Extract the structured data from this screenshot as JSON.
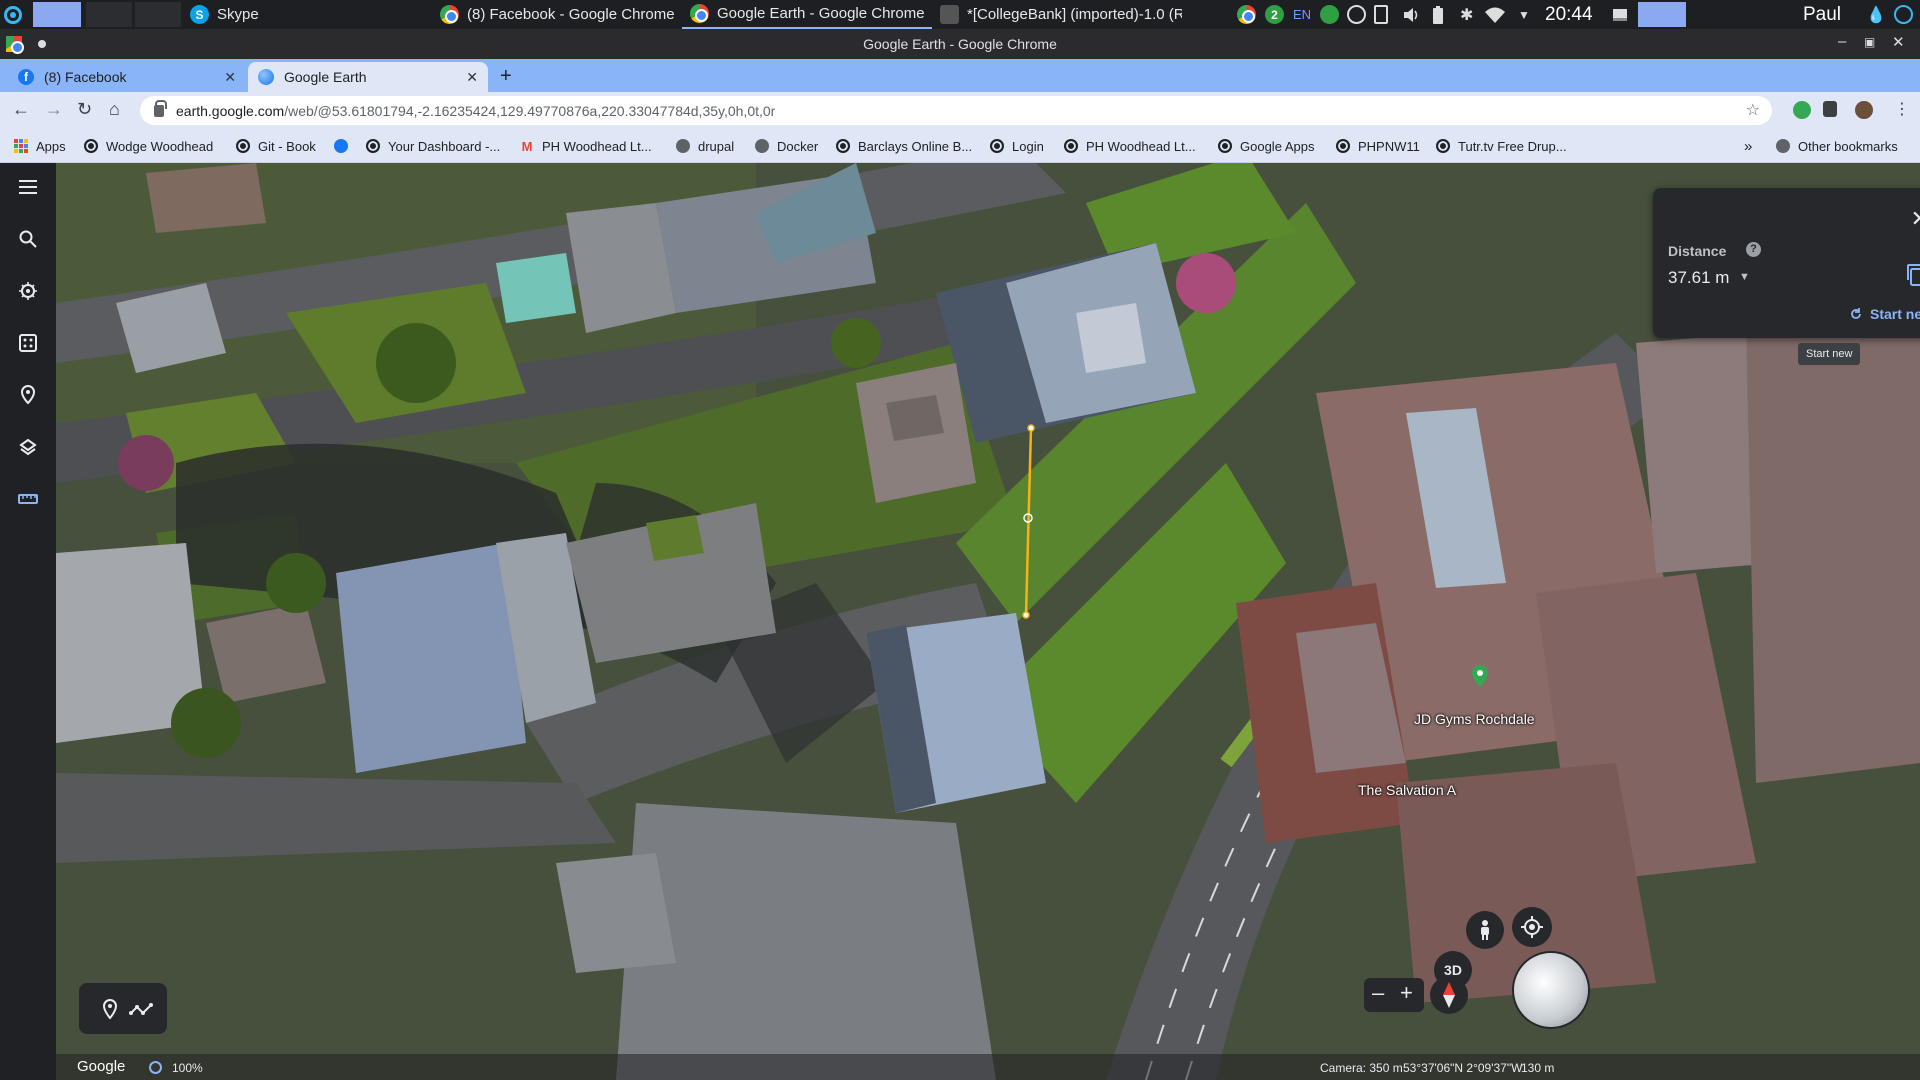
{
  "taskbar": {
    "tasks": [
      {
        "label": "Skype",
        "icon": "skype-icon"
      },
      {
        "label": "(8) Facebook - Google Chrome",
        "icon": "chrome-icon"
      },
      {
        "label": "Google Earth - Google Chrome",
        "icon": "chrome-icon"
      },
      {
        "label": "*[CollegeBank] (imported)-1.0 (R...",
        "icon": "gnucash-icon"
      }
    ],
    "tray": {
      "badge_count": "2",
      "language": "EN",
      "clock": "20:44",
      "user": "Paul"
    }
  },
  "window": {
    "title": "Google Earth - Google Chrome"
  },
  "tabs": [
    {
      "label": "(8) Facebook",
      "icon": "facebook-icon",
      "active": false
    },
    {
      "label": "Google Earth",
      "icon": "google-earth-icon",
      "active": true
    }
  ],
  "address": {
    "host": "earth.google.com",
    "path": "/web/@53.61801794,-2.16235424,129.49770876a,220.33047784d,35y,0h,0t,0r"
  },
  "bookmarks": {
    "items": [
      {
        "label": "Apps",
        "icon": "apps-grid-icon"
      },
      {
        "label": "Wodge Woodhead",
        "icon": "globe-icon"
      },
      {
        "label": "Git - Book",
        "icon": "globe-icon"
      },
      {
        "label": "",
        "icon": "facebook-icon"
      },
      {
        "label": "Your Dashboard -...",
        "icon": "globe-icon"
      },
      {
        "label": "PH Woodhead Lt...",
        "icon": "gmail-icon"
      },
      {
        "label": "drupal",
        "icon": "folder-icon"
      },
      {
        "label": "Docker",
        "icon": "folder-icon"
      },
      {
        "label": "Barclays Online B...",
        "icon": "globe-icon"
      },
      {
        "label": "Login",
        "icon": "globe-icon"
      },
      {
        "label": "PH Woodhead Lt...",
        "icon": "globe-icon"
      },
      {
        "label": "Google Apps",
        "icon": "globe-icon"
      },
      {
        "label": "PHPNW11",
        "icon": "globe-icon"
      },
      {
        "label": "Tutr.tv Free Drup...",
        "icon": "globe-icon"
      }
    ],
    "overflow": "»",
    "other": "Other bookmarks"
  },
  "earth": {
    "measure": {
      "label": "Distance",
      "value": "37.61 m",
      "start_new": "Start new",
      "tooltip": "Start new"
    },
    "labels": {
      "place1": "JD Gyms Rochdale",
      "place2": "The Salvation A",
      "btn_3d": "3D"
    },
    "status": {
      "brand": "Google",
      "load_percent": "100%",
      "camera": "Camera: 350 m",
      "coords": "53°37'06\"N 2°09'37\"W",
      "scale": "130 m"
    },
    "colors": {
      "measure_line": "#f5b21a",
      "accent": "#8ab4f8",
      "panel": "#26282b"
    }
  }
}
